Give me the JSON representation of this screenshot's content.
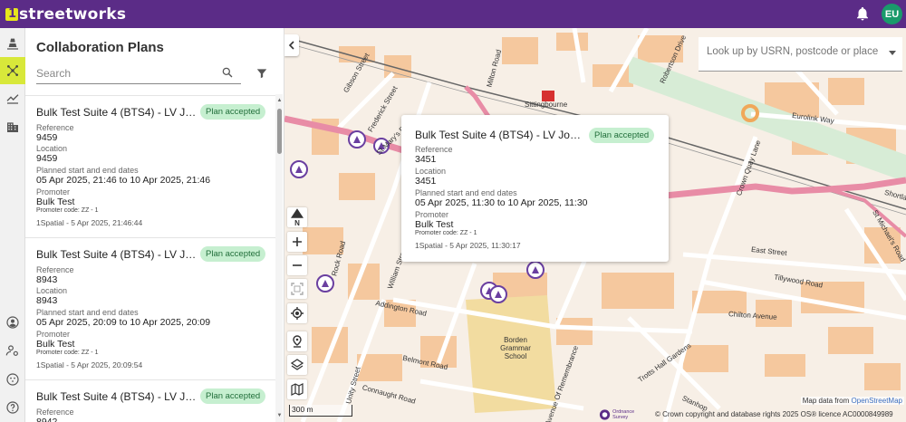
{
  "app": {
    "logo_text": "streetworks",
    "user_initials": "EU"
  },
  "rail": {
    "items": [
      {
        "icon": "works-cone-icon"
      },
      {
        "icon": "collaboration-network-icon"
      },
      {
        "icon": "analytics-icon"
      },
      {
        "icon": "buildings-icon"
      },
      {
        "icon": "account-icon"
      },
      {
        "icon": "users-settings-icon"
      },
      {
        "icon": "support-icon"
      },
      {
        "icon": "help-icon"
      }
    ]
  },
  "panel": {
    "title": "Collaboration Plans",
    "search_placeholder": "Search",
    "labels": {
      "reference": "Reference",
      "location": "Location",
      "dates": "Planned start and end dates",
      "promoter": "Promoter"
    },
    "plans": [
      {
        "title": "Bulk Test Suite 4 (BTS4) - LV Joint bay...",
        "status": "Plan accepted",
        "reference": "9459",
        "location": "9459",
        "dates": "05 Apr 2025, 21:46 to 10 Apr 2025, 21:46",
        "promoter": "Bulk Test",
        "promoter_code": "Promoter code: ZZ - 1",
        "footer": "1Spatial - 5 Apr 2025, 21:46:44"
      },
      {
        "title": "Bulk Test Suite 4 (BTS4) - LV Joint bay...",
        "status": "Plan accepted",
        "reference": "8943",
        "location": "8943",
        "dates": "05 Apr 2025, 20:09 to 10 Apr 2025, 20:09",
        "promoter": "Bulk Test",
        "promoter_code": "Promoter code: ZZ - 1",
        "footer": "1Spatial - 5 Apr 2025, 20:09:54"
      },
      {
        "title": "Bulk Test Suite 4 (BTS4) - LV Joint bay...",
        "status": "Plan accepted",
        "reference": "8942",
        "location": "",
        "dates": "",
        "promoter": "",
        "promoter_code": "",
        "footer": ""
      }
    ]
  },
  "map": {
    "lookup_placeholder": "Look up by USRN, postcode or place",
    "north_label": "N",
    "scale_label": "300 m",
    "attribution_prefix": "Map data from ",
    "attribution_link": "OpenStreetMap",
    "os_logo_text": "Ordnance Survey",
    "copyright": "© Crown copyright and database rights 2025 OS® licence AC0000849989",
    "popup": {
      "title": "Bulk Test Suite 4 (BTS4) - LV Joint bay...",
      "status": "Plan accepted",
      "reference": "3451",
      "location": "3451",
      "dates": "05 Apr 2025, 11:30 to 10 Apr 2025, 11:30",
      "promoter": "Bulk Test",
      "promoter_code": "Promoter code: ZZ - 1",
      "footer": "1Spatial - 5 Apr 2025, 11:30:17"
    },
    "labels": {
      "sittingbourne": "Sittingbourne",
      "eurolink_way": "Eurolink Way",
      "east_street": "East Street",
      "tillywood_road": "Tillywood Road",
      "chilton_avenue": "Chilton Avenue",
      "borden_school": "Borden Grammar School",
      "addington_road": "Addington Road",
      "belmont_road": "Belmont Road",
      "connaught_road": "Connaught Road",
      "avenue_of_remembrance": "Avenue Of Remembrance",
      "trotts_hall_gardens": "Trotts Hall Gardens",
      "rock_road": "Rock Road",
      "frederick_street": "Frederick Street",
      "gibson_street": "Gibson Street",
      "milton_road": "Milton Road",
      "robertson_drive": "Robertson Drive",
      "crown_quay_lane": "Crown Quay Lane",
      "st_michaels_road": "St Michael's Road",
      "shortlands": "Shortla",
      "unity_street": "Unity Street",
      "william_street": "William Street",
      "stanhope": "Stanhop",
      "st_marys": "St Mary's Road"
    }
  }
}
